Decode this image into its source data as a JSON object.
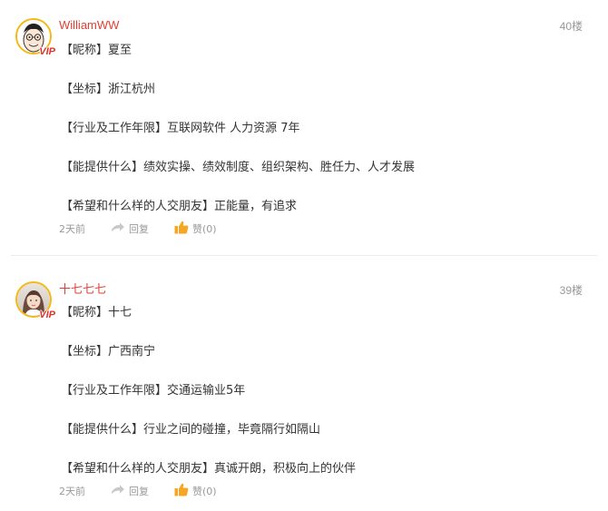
{
  "posts": [
    {
      "username": "WilliamWW",
      "floor": "40楼",
      "vip_label": "VIP",
      "lines": [
        "【昵称】夏至",
        "【坐标】浙江杭州",
        "【行业及工作年限】互联网软件 人力资源 7年",
        "【能提供什么】绩效实操、绩效制度、组织架构、胜任力、人才发展",
        "【希望和什么样的人交朋友】正能量，有追求"
      ],
      "time": "2天前",
      "reply_label": "回复",
      "like_label": "赞",
      "like_count": "(0)",
      "avatar_icon": "cartoon-face-avatar"
    },
    {
      "username": "十七七七",
      "floor": "39楼",
      "vip_label": "VIP",
      "lines": [
        "【昵称】十七",
        "【坐标】广西南宁",
        "【行业及工作年限】交通运输业5年",
        "【能提供什么】行业之间的碰撞，毕竟隔行如隔山",
        "【希望和什么样的人交朋友】真诚开朗，积极向上的伙伴"
      ],
      "time": "2天前",
      "reply_label": "回复",
      "like_label": "赞",
      "like_count": "(0)",
      "avatar_icon": "photo-avatar"
    }
  ],
  "colors": {
    "username": "#e33e33",
    "vip_border": "#f5b913",
    "vip_text": "#e0302b",
    "like_icon": "#f5a623",
    "meta": "#999999",
    "divider": "#ececec"
  }
}
